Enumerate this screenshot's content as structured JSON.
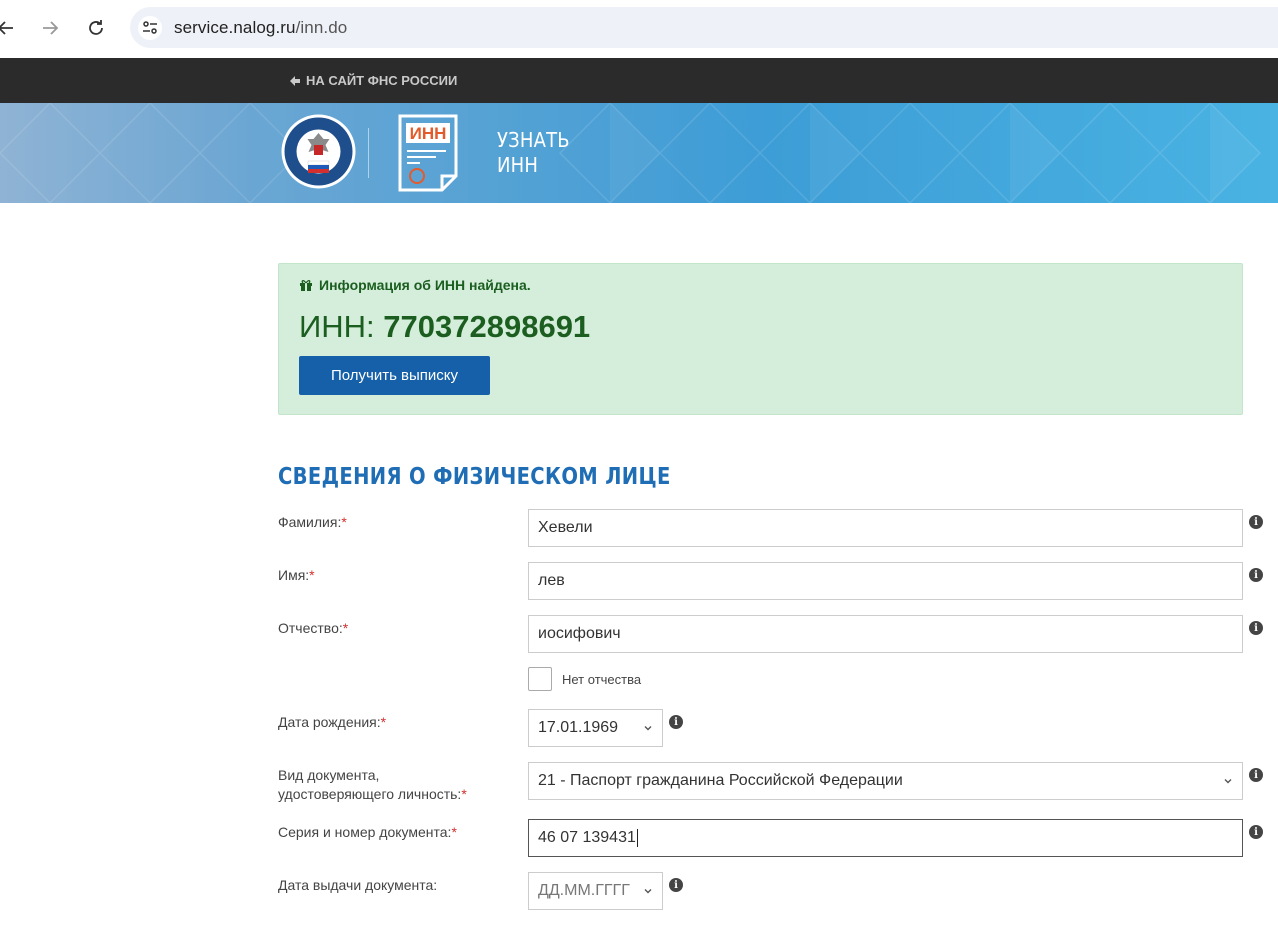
{
  "browser": {
    "url_domain": "service.nalog.ru",
    "url_path": "/inn.do"
  },
  "header": {
    "back_link": "НА САЙТ ФНС РОССИИ",
    "service_title_line1": "УЗНАТЬ",
    "service_title_line2": "ИНН",
    "inn_doc_label": "ИНН"
  },
  "result": {
    "message": "Информация об ИНН найдена.",
    "inn_prefix": "ИНН: ",
    "inn_value": "770372898691",
    "extract_button": "Получить выписку"
  },
  "form": {
    "section_title": "СВЕДЕНИЯ О ФИЗИЧЕСКОМ ЛИЦЕ",
    "required_mark": "*",
    "surname_label": "Фамилия:",
    "surname_value": "Хевели",
    "name_label": "Имя:",
    "name_value": "лев",
    "patronymic_label": "Отчество:",
    "patronymic_value": "иосифович",
    "no_patronymic_label": "Нет отчества",
    "no_patronymic_checked": false,
    "birthdate_label": "Дата рождения:",
    "birthdate_value": "17.01.1969",
    "doc_type_label_line1": "Вид документа,",
    "doc_type_label_line2": "удостоверяющего личность:",
    "doc_type_value": "21 - Паспорт гражданина Российской Федерации",
    "doc_number_label": "Серия и номер документа:",
    "doc_number_value": "46 07 139431",
    "doc_issue_date_label": "Дата выдачи документа:",
    "doc_issue_date_placeholder": "ДД.ММ.ГГГГ"
  },
  "colors": {
    "primary_button": "#1560a8",
    "success_bg": "#d5eedb",
    "success_text": "#1b5e20",
    "section_title": "#1f6db5",
    "required": "#d32f2f",
    "topbar": "#2b2b2b"
  }
}
